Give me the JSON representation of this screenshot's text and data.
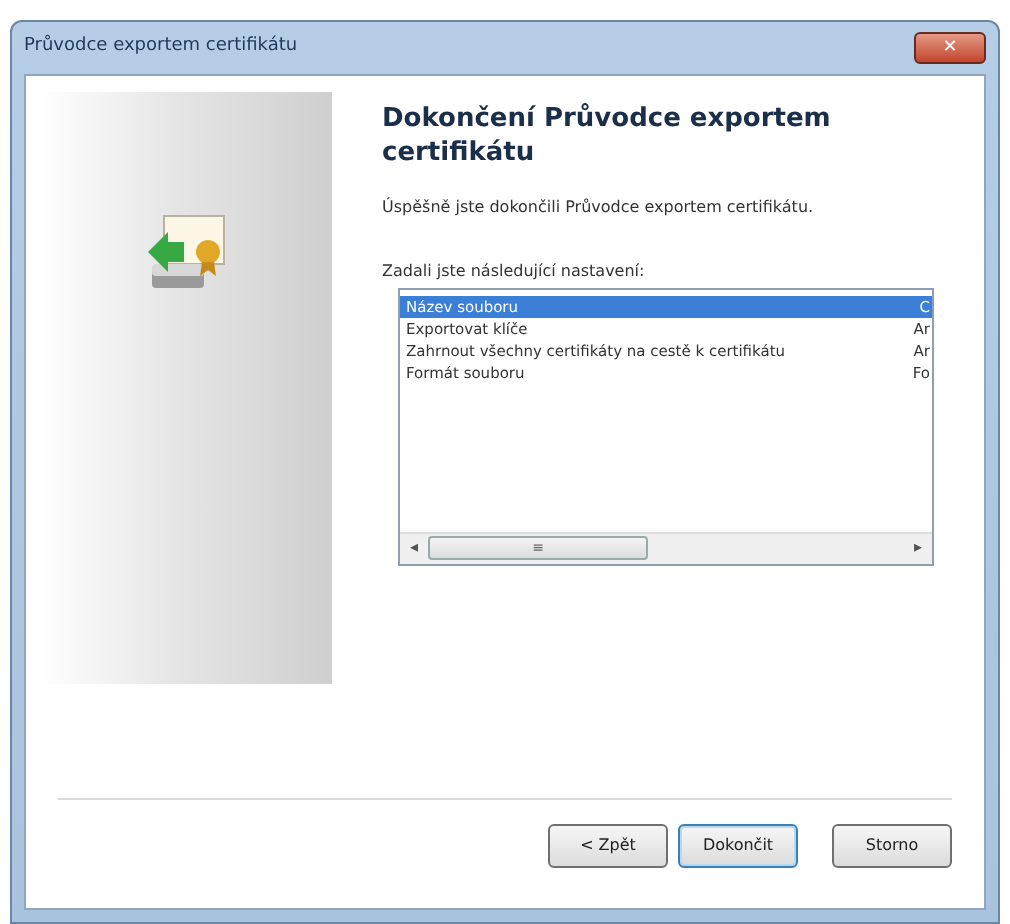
{
  "window": {
    "title": "Průvodce exportem certifikátu",
    "close_label": "✕"
  },
  "heading": "Dokončení Průvodce exportem certifikátu",
  "message": "Úspěšně jste dokončili Průvodce exportem certifikátu.",
  "settings_label": "Zadali jste následující nastavení:",
  "settings": [
    {
      "name": "Název souboru",
      "value": "C",
      "selected": true
    },
    {
      "name": "Exportovat klíče",
      "value": "Ar",
      "selected": false
    },
    {
      "name": "Zahrnout všechny certifikáty na cestě k certifikátu",
      "value": "Ar",
      "selected": false
    },
    {
      "name": "Formát souboru",
      "value": "Fo",
      "selected": false
    }
  ],
  "scrollbar": {
    "left": "◂",
    "right": "▸",
    "grip": "≡"
  },
  "buttons": [
    {
      "label": "< Zpět",
      "kind": "back",
      "default": false
    },
    {
      "label": "Dokončit",
      "kind": "finish",
      "default": true
    },
    {
      "label": "Storno",
      "kind": "cancel",
      "default": false
    }
  ]
}
